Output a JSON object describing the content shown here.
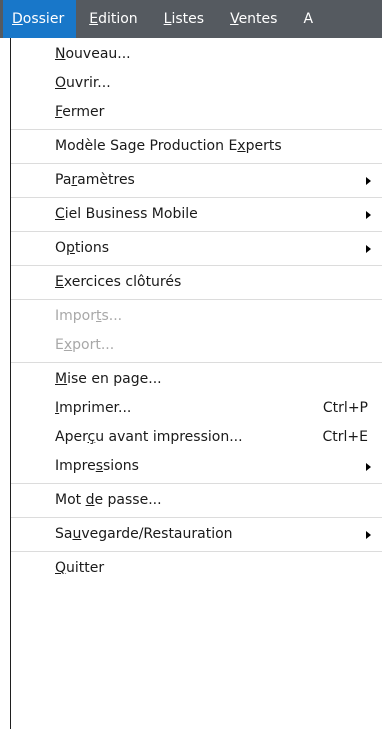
{
  "menubar": {
    "items": [
      {
        "pre": "",
        "u": "D",
        "post": "ossier"
      },
      {
        "pre": "",
        "u": "E",
        "post": "dition"
      },
      {
        "pre": "",
        "u": "L",
        "post": "istes"
      },
      {
        "pre": "",
        "u": "V",
        "post": "entes"
      },
      {
        "pre": "A",
        "u": "",
        "post": ""
      }
    ]
  },
  "dossier_menu": {
    "groups": [
      {
        "items": [
          {
            "pre": "",
            "u": "N",
            "post": "ouveau...",
            "shortcut": "",
            "submenu": false,
            "disabled": false
          },
          {
            "pre": "",
            "u": "O",
            "post": "uvrir...",
            "shortcut": "",
            "submenu": false,
            "disabled": false
          },
          {
            "pre": "",
            "u": "F",
            "post": "ermer",
            "shortcut": "",
            "submenu": false,
            "disabled": false
          }
        ]
      },
      {
        "items": [
          {
            "pre": "Modèle Sage Production E",
            "u": "x",
            "post": "perts",
            "shortcut": "",
            "submenu": false,
            "disabled": false
          }
        ]
      },
      {
        "items": [
          {
            "pre": "Pa",
            "u": "r",
            "post": "amètres",
            "shortcut": "",
            "submenu": true,
            "disabled": false
          }
        ]
      },
      {
        "items": [
          {
            "pre": "",
            "u": "C",
            "post": "iel Business Mobile",
            "shortcut": "",
            "submenu": true,
            "disabled": false
          }
        ]
      },
      {
        "items": [
          {
            "pre": "O",
            "u": "p",
            "post": "tions",
            "shortcut": "",
            "submenu": true,
            "disabled": false
          }
        ]
      },
      {
        "items": [
          {
            "pre": "",
            "u": "E",
            "post": "xercices clôturés",
            "shortcut": "",
            "submenu": false,
            "disabled": false
          }
        ]
      },
      {
        "items": [
          {
            "pre": "Impor",
            "u": "t",
            "post": "s...",
            "shortcut": "",
            "submenu": false,
            "disabled": true
          },
          {
            "pre": "E",
            "u": "x",
            "post": "port...",
            "shortcut": "",
            "submenu": false,
            "disabled": true
          }
        ]
      },
      {
        "items": [
          {
            "pre": "",
            "u": "M",
            "post": "ise en page...",
            "shortcut": "",
            "submenu": false,
            "disabled": false
          },
          {
            "pre": "",
            "u": "I",
            "post": "mprimer...",
            "shortcut": "Ctrl+P",
            "submenu": false,
            "disabled": false
          },
          {
            "pre": "Aper",
            "u": "ç",
            "post": "u avant impression...",
            "shortcut": "Ctrl+E",
            "submenu": false,
            "disabled": false
          },
          {
            "pre": "Impre",
            "u": "s",
            "post": "sions",
            "shortcut": "",
            "submenu": true,
            "disabled": false
          }
        ]
      },
      {
        "items": [
          {
            "pre": "Mot ",
            "u": "d",
            "post": "e passe...",
            "shortcut": "",
            "submenu": false,
            "disabled": false
          }
        ]
      },
      {
        "items": [
          {
            "pre": "Sa",
            "u": "u",
            "post": "vegarde/Restauration",
            "shortcut": "",
            "submenu": true,
            "disabled": false
          }
        ]
      },
      {
        "items": [
          {
            "pre": "",
            "u": "Q",
            "post": "uitter",
            "shortcut": "",
            "submenu": false,
            "disabled": false
          }
        ]
      }
    ]
  },
  "colors": {
    "menubar_bg": "#555a60",
    "menubar_active": "#1877c9",
    "disabled_text": "#a8a8a8"
  },
  "icons": {
    "submenu": "submenu-arrow-icon"
  }
}
